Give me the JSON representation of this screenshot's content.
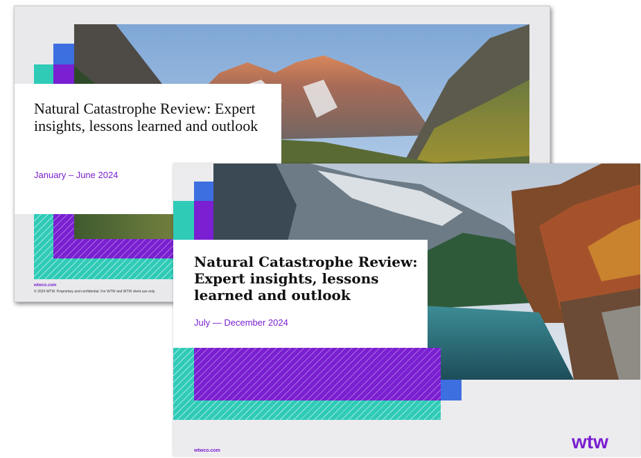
{
  "slides": {
    "back": {
      "title": "Natural Catastrophe Review: Expert insights, lessons learned and outlook",
      "subtitle": "January – June 2024",
      "footer_url": "wtwco.com",
      "footer_copy": "© 2024 WTW. Proprietary and confidential. For WTW and WTW client use only."
    },
    "front": {
      "title": "Natural Catastrophe Review: Expert insights, lessons learned and outlook",
      "subtitle": "July — December 2024",
      "footer_url": "wtwco.com",
      "logo": "wtw"
    }
  },
  "colors": {
    "teal": "#2fcbb7",
    "purple": "#7a1fd1",
    "blue": "#3d6fe0"
  }
}
